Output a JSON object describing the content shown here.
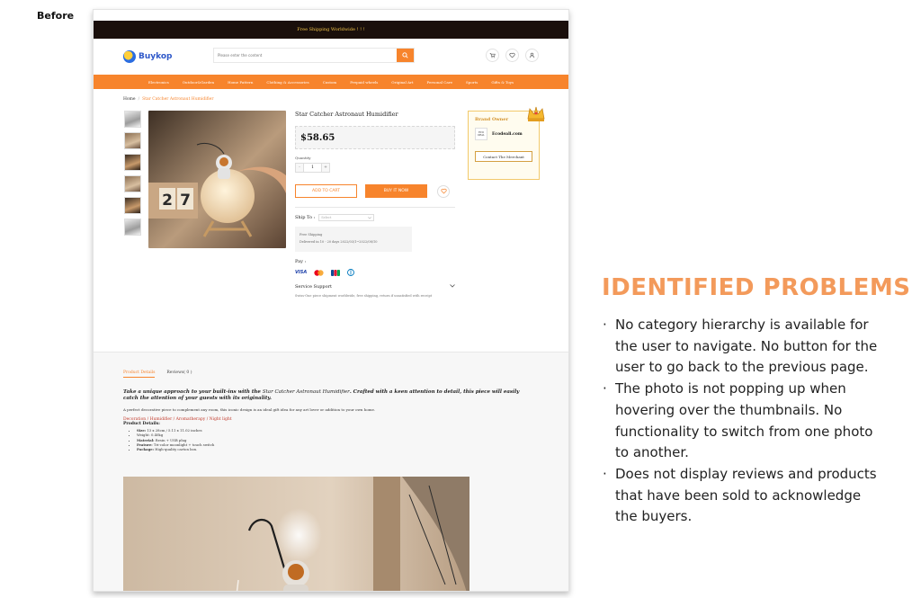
{
  "slide": {
    "before_label": "Before",
    "problems_title": "IDENTIFIED PROBLEMS",
    "problems": [
      "No category hierarchy is available for the user to navigate. No button for the user to go back to the previous page.",
      "The photo is not popping up when hovering over the thumbnails. No functionality to switch from one photo to another.",
      "Does not display reviews and products that have been sold to acknowledge the buyers."
    ]
  },
  "site": {
    "banner": "Free Shipping Worldwide ! ! !",
    "logo": "Buykop",
    "search_placeholder": "Please enter the content",
    "nav": [
      "Electronics",
      "Outdoor&Garden",
      "Home Pattern",
      "Clothing & Accessories",
      "Custom",
      "Prepaid wheels",
      "Original Art",
      "Personal Care",
      "Sports",
      "Gifts & Toys"
    ]
  },
  "breadcrumb": {
    "home": "Home",
    "current": "Star Catcher Astronaut Humidifier"
  },
  "product": {
    "title": "Star Catcher Astronaut Humidifier",
    "price": "$58.65",
    "quantity_label": "Quantity",
    "quantity": "1",
    "minus": "-",
    "plus": "+",
    "add_to_cart": "ADD TO CART",
    "buy_now": "BUY IT NOW",
    "ship_to_label": "Ship To :",
    "ship_select": "Select",
    "shipping_title": "Free Shipping",
    "shipping_detail": "Delivered in 10 - 20 days   2022/03/1~2022/08/10",
    "pay_label": "Pay :",
    "service_label": "Service Support",
    "service_desc": "Swiss-One piece shipment worldwide, free shipping, return if unsatisfied with receipt"
  },
  "merchant": {
    "title": "Brand Owner",
    "logo_text": "ECO DEAL",
    "name": "Ecodeali.com",
    "contact": "Contact The Merchant"
  },
  "details": {
    "tab_details": "Product Details",
    "tab_reviews": "Reviews( 0 )",
    "lead_a": "Take a unique approach to your built-ins with the ",
    "lead_name": "Star Catcher Astronaut Humidifier",
    "lead_b": ". Crafted with a keen attention to detail, this piece will easily catch the attention of your guests with its originality.",
    "paragraph": "A perfect decorative piece to complement any room, this iconic design is an ideal gift idea for any art lover or addition to your own home.",
    "category": "Decoration / Humidifier / Aromatherapy / Night light",
    "details_head": "Product Details:",
    "specs": [
      {
        "k": "Size:",
        "v": " 13 x 28cm / 5.11 x 11.02 inches"
      },
      {
        "k": "",
        "v": "Weight: 0.40kg"
      },
      {
        "k": "Material:",
        "v": " Resin + USB plug"
      },
      {
        "k": "Feature:",
        "v": " Tri-color moonlight + touch switch"
      },
      {
        "k": "Package:",
        "v": " High-quality carton box."
      }
    ]
  },
  "colors": {
    "accent": "#f7842c",
    "title_accent": "#f39a5b",
    "banner_bg": "#1a0f0b"
  }
}
